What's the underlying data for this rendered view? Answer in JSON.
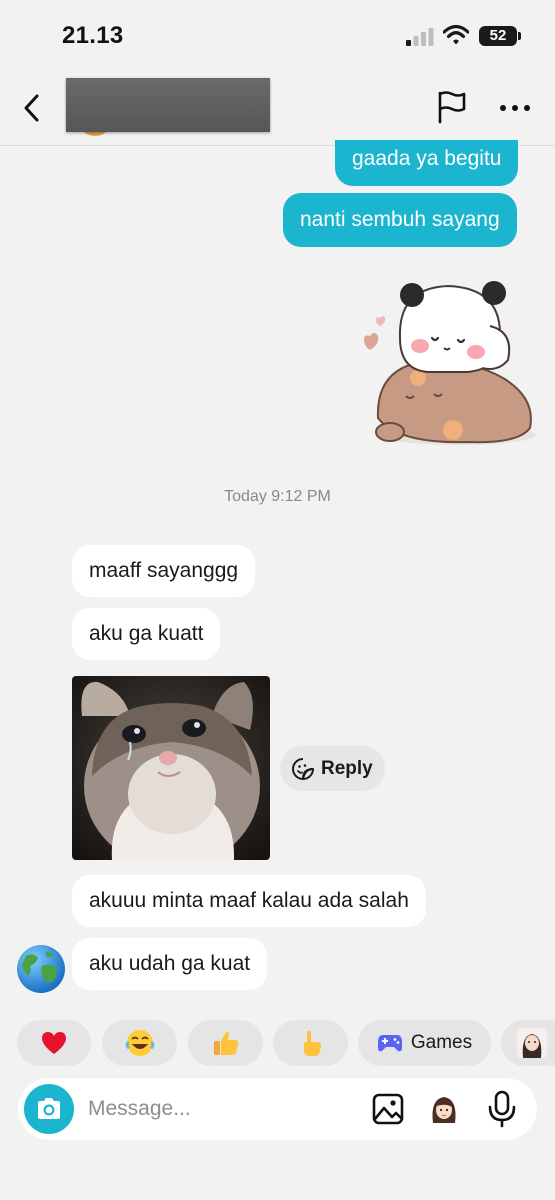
{
  "status_bar": {
    "time": "21.13",
    "battery": "52"
  },
  "header": {
    "back_icon": "chevron-left-icon",
    "flag_icon": "flag-icon",
    "more_icon": "more-horizontal-icon"
  },
  "messages": {
    "out_1": "gaada ya begitu",
    "out_2": "nanti sembuh sayang",
    "timestamp": "Today 9:12 PM",
    "in_1": "maaff sayanggg",
    "in_2": "aku ga kuatt",
    "in_3": "akuuu minta maaf kalau ada salah",
    "in_4": "aku udah ga kuat"
  },
  "reply_button": {
    "label": "Reply",
    "icon": "sticker-icon"
  },
  "quick_reactions": [
    {
      "emoji": "❤️",
      "icon": "heart-icon"
    },
    {
      "emoji": "😂",
      "icon": "laughing-face-icon"
    },
    {
      "emoji": "👍",
      "icon": "thumbs-up-icon"
    },
    {
      "emoji": "👆",
      "icon": "pointing-hand-icon"
    },
    {
      "label": "Games",
      "icon": "gamepad-icon"
    }
  ],
  "composer": {
    "placeholder": "Message...",
    "value": "",
    "camera_icon": "camera-icon",
    "gallery_icon": "image-icon",
    "mic_icon": "microphone-icon"
  },
  "colors": {
    "accent": "#1cb5cf",
    "background": "#f2f2f2",
    "bubble_in": "#ffffff",
    "chip": "#e5e5e5"
  }
}
